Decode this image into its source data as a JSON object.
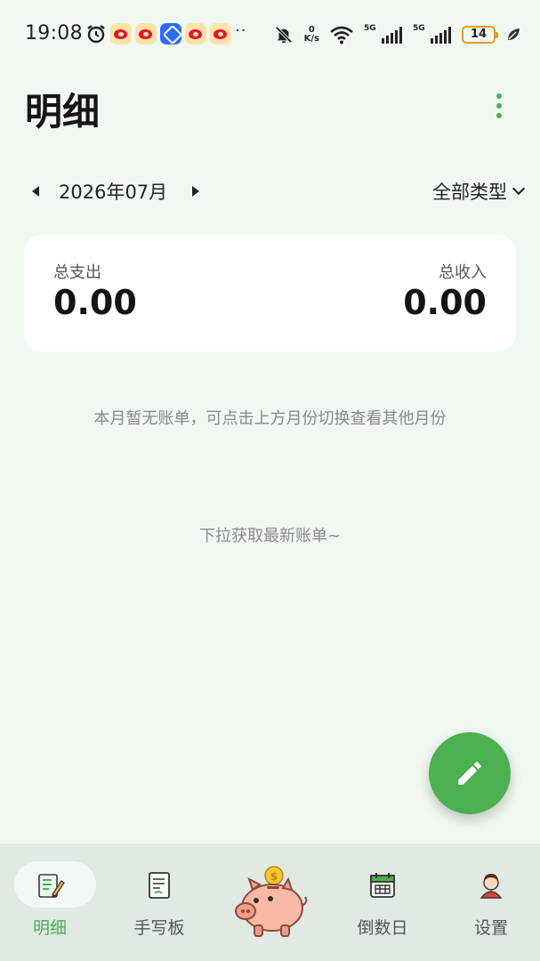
{
  "status_bar": {
    "time": "19:08",
    "notification_icons": [
      "alarm-icon",
      "weibo-icon",
      "weibo-icon",
      "tencent-app-icon",
      "weibo-icon",
      "weibo-icon"
    ],
    "overflow": "··",
    "net_speed_value": "0",
    "net_speed_unit": "K/s",
    "signal_1_label": "5G",
    "signal_2_label": "5G",
    "battery": "14"
  },
  "header": {
    "title": "明细"
  },
  "filter": {
    "month": "2026年07月",
    "type": "全部类型"
  },
  "summary": {
    "expense_label": "总支出",
    "expense_value": "0.00",
    "income_label": "总收入",
    "income_value": "0.00"
  },
  "main": {
    "empty_message": "本月暂无账单，可点击上方月份切换查看其他月份",
    "pull_hint": "下拉获取最新账单~"
  },
  "tabs": [
    {
      "label": "明细",
      "icon": "notepad-pen-icon",
      "active": true
    },
    {
      "label": "手写板",
      "icon": "handwriting-board-icon",
      "active": false
    },
    {
      "label": "",
      "icon": "piggy-bank-icon",
      "active": false
    },
    {
      "label": "倒数日",
      "icon": "calendar-icon",
      "active": false
    },
    {
      "label": "设置",
      "icon": "user-avatar-icon",
      "active": false
    }
  ],
  "colors": {
    "accent": "#4caf50",
    "background": "#f1f8f1",
    "tabbar": "#e1eae2"
  }
}
